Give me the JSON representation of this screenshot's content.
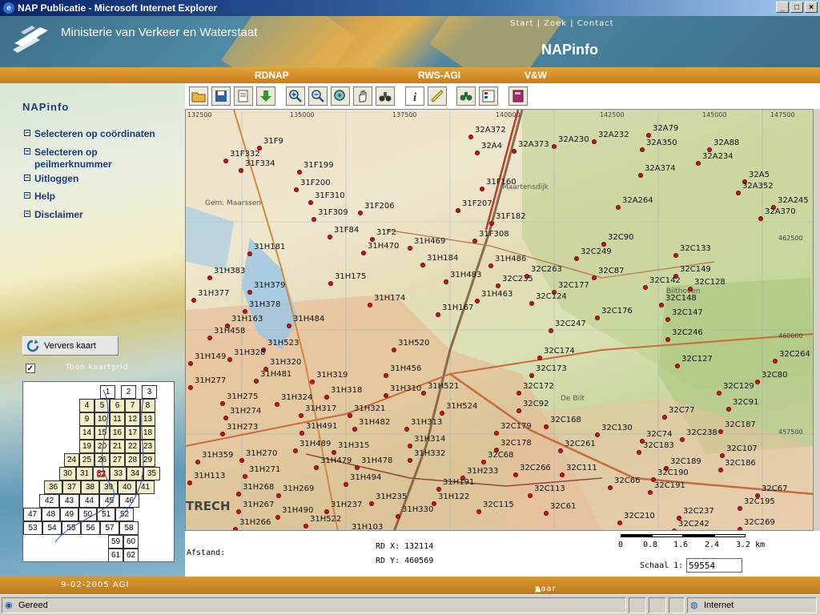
{
  "window": {
    "title": "NAP Publicatie - Microsoft Internet Explorer",
    "buttons": [
      "_",
      "□",
      "×"
    ]
  },
  "banner": {
    "ministry": "Ministerie van Verkeer en Waterstaat",
    "top_links": "Start | Zoek | Contact",
    "site_name": "NAPinfo"
  },
  "nav": {
    "items": [
      "RDNAP",
      "RWS-AGI",
      "V&W"
    ]
  },
  "sidebar": {
    "title": "NAPinfo",
    "menu": [
      "Selecteren op coördinaten",
      "Selecteren op peilmerknummer",
      "Uitloggen",
      "Help",
      "Disclaimer"
    ],
    "refresh_button": "Ververs kaart",
    "grid_checkbox_label": "Toon kaartgrid",
    "grid_checked": true,
    "overview_cells": [
      "1",
      "2",
      "3",
      "4",
      "5",
      "6",
      "7",
      "8",
      "9",
      "10",
      "11",
      "12",
      "13",
      "14",
      "15",
      "16",
      "17",
      "18",
      "19",
      "20",
      "21",
      "22",
      "23",
      "24",
      "25",
      "26",
      "27",
      "28",
      "29",
      "30",
      "31",
      "32",
      "33",
      "34",
      "35",
      "36",
      "37",
      "38",
      "39",
      "40",
      "41",
      "42",
      "43",
      "44",
      "45",
      "46",
      "47",
      "48",
      "49",
      "50",
      "51",
      "52",
      "53",
      "54",
      "55",
      "56",
      "57",
      "58",
      "59",
      "60",
      "61",
      "62"
    ]
  },
  "toolbar": {
    "tools": [
      "open-folder-icon",
      "save-icon",
      "print-icon",
      "download-icon",
      "zoom-in-icon",
      "zoom-out-icon",
      "zoom-full-icon",
      "pan-hand-icon",
      "binoculars-icon",
      "info-icon",
      "measure-ruler-icon",
      "search-binoculars-icon",
      "legend-icon",
      "book-icon"
    ]
  },
  "map": {
    "grid_labels": [
      "132500",
      "135000",
      "137500",
      "140000",
      "142500",
      "145000",
      "147500",
      "462500",
      "460000",
      "457500"
    ],
    "place_labels": [
      "Maartensdijk",
      "Bilthoven",
      "TRECH",
      "De Bilt",
      "Gem. Maarssen"
    ],
    "points": [
      {
        "id": "31F9"
      },
      {
        "id": "31F332"
      },
      {
        "id": "31F334"
      },
      {
        "id": "31F199"
      },
      {
        "id": "31F200"
      },
      {
        "id": "31F310"
      },
      {
        "id": "31F309"
      },
      {
        "id": "31F206"
      },
      {
        "id": "31F84"
      },
      {
        "id": "31F2"
      },
      {
        "id": "31H469"
      },
      {
        "id": "31H470"
      },
      {
        "id": "31H184"
      },
      {
        "id": "31F308"
      },
      {
        "id": "31F160"
      },
      {
        "id": "31F207"
      },
      {
        "id": "31F182"
      },
      {
        "id": "31H486"
      },
      {
        "id": "31H181"
      },
      {
        "id": "31H383"
      },
      {
        "id": "31H377"
      },
      {
        "id": "31H379"
      },
      {
        "id": "31H175"
      },
      {
        "id": "31H483"
      },
      {
        "id": "32C235"
      },
      {
        "id": "31H463"
      },
      {
        "id": "31H174"
      },
      {
        "id": "31H378"
      },
      {
        "id": "31H163"
      },
      {
        "id": "31H484"
      },
      {
        "id": "31H167"
      },
      {
        "id": "31H458"
      },
      {
        "id": "31H523"
      },
      {
        "id": "31H149"
      },
      {
        "id": "31H328"
      },
      {
        "id": "31H520"
      },
      {
        "id": "31H320"
      },
      {
        "id": "31H456"
      },
      {
        "id": "31H481"
      },
      {
        "id": "31H319"
      },
      {
        "id": "31H277"
      },
      {
        "id": "31H318"
      },
      {
        "id": "31H310"
      },
      {
        "id": "31H521"
      },
      {
        "id": "31H275"
      },
      {
        "id": "31H324"
      },
      {
        "id": "31H321"
      },
      {
        "id": "31H274"
      },
      {
        "id": "31H317"
      },
      {
        "id": "31H524"
      },
      {
        "id": "31H273"
      },
      {
        "id": "31H491"
      },
      {
        "id": "31H482"
      },
      {
        "id": "31H313"
      },
      {
        "id": "31H489"
      },
      {
        "id": "31H314"
      },
      {
        "id": "31H315"
      },
      {
        "id": "31H359"
      },
      {
        "id": "31H270"
      },
      {
        "id": "31H332"
      },
      {
        "id": "31H479"
      },
      {
        "id": "31H478"
      },
      {
        "id": "31H113"
      },
      {
        "id": "31H271"
      },
      {
        "id": "31H494"
      },
      {
        "id": "31H233"
      },
      {
        "id": "31H191"
      },
      {
        "id": "31H268"
      },
      {
        "id": "31H269"
      },
      {
        "id": "31H235"
      },
      {
        "id": "31H122"
      },
      {
        "id": "31H267"
      },
      {
        "id": "31H490"
      },
      {
        "id": "31H237"
      },
      {
        "id": "31H330"
      },
      {
        "id": "31H266"
      },
      {
        "id": "31H522"
      },
      {
        "id": "31H103"
      },
      {
        "id": "32A372"
      },
      {
        "id": "32A4"
      },
      {
        "id": "32A373"
      },
      {
        "id": "32A230"
      },
      {
        "id": "32A232"
      },
      {
        "id": "32A79"
      },
      {
        "id": "32A350"
      },
      {
        "id": "32A88"
      },
      {
        "id": "32A234"
      },
      {
        "id": "32A374"
      },
      {
        "id": "32A5"
      },
      {
        "id": "32A352"
      },
      {
        "id": "32A264"
      },
      {
        "id": "32A245"
      },
      {
        "id": "32A370"
      },
      {
        "id": "32C90"
      },
      {
        "id": "32C249"
      },
      {
        "id": "32C133"
      },
      {
        "id": "32C263"
      },
      {
        "id": "32C87"
      },
      {
        "id": "32C149"
      },
      {
        "id": "32C177"
      },
      {
        "id": "32C142"
      },
      {
        "id": "32C128"
      },
      {
        "id": "32C124"
      },
      {
        "id": "32C148"
      },
      {
        "id": "32C176"
      },
      {
        "id": "32C147"
      },
      {
        "id": "32C247"
      },
      {
        "id": "32C246"
      },
      {
        "id": "32C174"
      },
      {
        "id": "32C127"
      },
      {
        "id": "32C264"
      },
      {
        "id": "32C173"
      },
      {
        "id": "32C80"
      },
      {
        "id": "32C172"
      },
      {
        "id": "32C129"
      },
      {
        "id": "32C92"
      },
      {
        "id": "32C91"
      },
      {
        "id": "32C168"
      },
      {
        "id": "32C77"
      },
      {
        "id": "32C179"
      },
      {
        "id": "32C130"
      },
      {
        "id": "32C74"
      },
      {
        "id": "32C238"
      },
      {
        "id": "32C187"
      },
      {
        "id": "32C178"
      },
      {
        "id": "32C261"
      },
      {
        "id": "32C183"
      },
      {
        "id": "32C107"
      },
      {
        "id": "32C68"
      },
      {
        "id": "32C189"
      },
      {
        "id": "32C266"
      },
      {
        "id": "32C111"
      },
      {
        "id": "32C190"
      },
      {
        "id": "32C186"
      },
      {
        "id": "32C66"
      },
      {
        "id": "32C191"
      },
      {
        "id": "32C113"
      },
      {
        "id": "32C67"
      },
      {
        "id": "32C115"
      },
      {
        "id": "32C61"
      },
      {
        "id": "32C195"
      },
      {
        "id": "32C237"
      },
      {
        "id": "32C210"
      },
      {
        "id": "32C242"
      },
      {
        "id": "32C269"
      }
    ]
  },
  "info": {
    "afstand_label": "Afstand:",
    "rd_x": "RD X: 132114",
    "rd_y": "RD Y: 460569",
    "scale_ticks": [
      "0",
      "0.8",
      "1.6",
      "2.4",
      "3.2 km"
    ],
    "schaal_label": "Schaal 1:",
    "schaal_value": "59554"
  },
  "footer": {
    "date": "9-02-2005 AGI",
    "to_top": "naar boven"
  },
  "statusbar": {
    "status": "Gereed",
    "zone": "Internet"
  }
}
